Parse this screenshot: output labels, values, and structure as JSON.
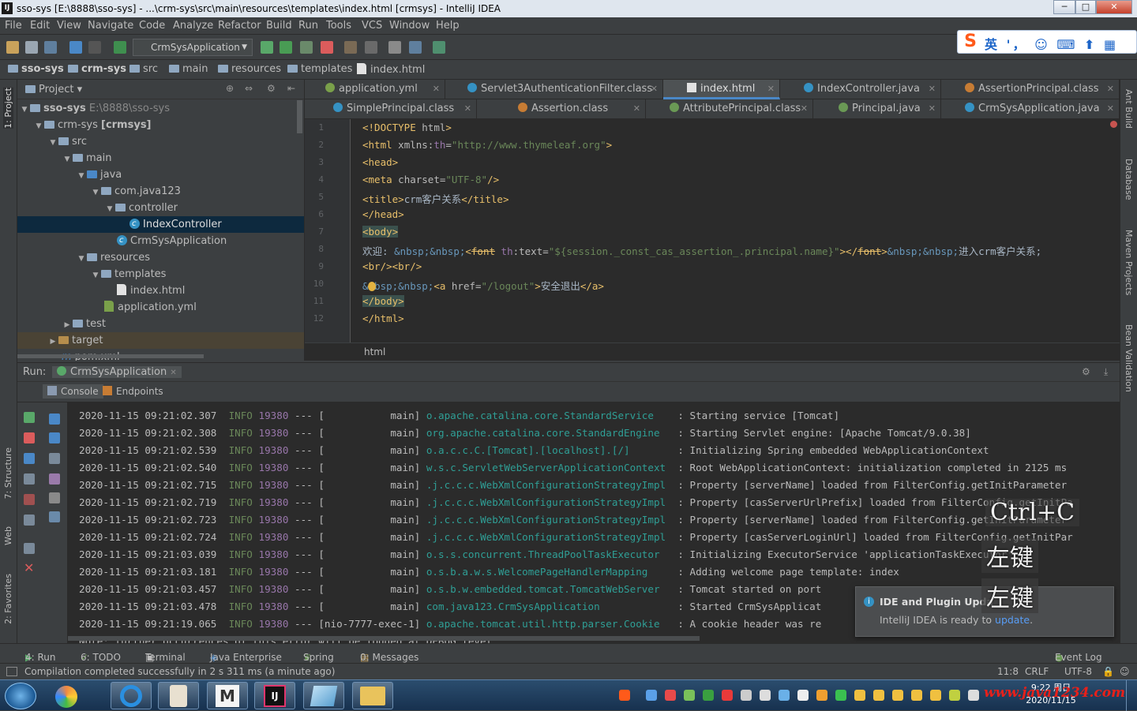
{
  "window": {
    "title": "sso-sys [E:\\8888\\sso-sys] - ...\\crm-sys\\src\\main\\resources\\templates\\index.html [crmsys] - IntelliJ IDEA",
    "app_icon": "IJ",
    "buttons": [
      "─",
      "□",
      "✕"
    ]
  },
  "menu": [
    "File",
    "Edit",
    "View",
    "Navigate",
    "Code",
    "Analyze",
    "Refactor",
    "Build",
    "Run",
    "Tools",
    "VCS",
    "Window",
    "Help"
  ],
  "toolbar": {
    "run_config": "CrmSysApplication"
  },
  "ime": {
    "mode": "英",
    "punct": "'，",
    "logo": "S"
  },
  "breadcrumb_nav": [
    "sso-sys",
    "crm-sys",
    "src",
    "main",
    "resources",
    "templates",
    "index.html"
  ],
  "project_panel": {
    "title": "Project",
    "tree": [
      {
        "label": "sso-sys",
        "extra": "E:\\8888\\sso-sys"
      },
      {
        "label": "crm-sys",
        "extra": "[crmsys]"
      },
      {
        "label": "src"
      },
      {
        "label": "main"
      },
      {
        "label": "java"
      },
      {
        "label": "com.java123"
      },
      {
        "label": "controller"
      },
      {
        "label": "IndexController"
      },
      {
        "label": "CrmSysApplication"
      },
      {
        "label": "resources"
      },
      {
        "label": "templates"
      },
      {
        "label": "index.html"
      },
      {
        "label": "application.yml"
      },
      {
        "label": "test"
      },
      {
        "label": "target"
      },
      {
        "label": "pom.xml"
      }
    ]
  },
  "editor_tabs_row1": [
    "application.yml",
    "Servlet3AuthenticationFilter.class",
    "index.html",
    "IndexController.java",
    "AssertionPrincipal.class"
  ],
  "editor_tabs_row2": [
    "SimplePrincipal.class",
    "Assertion.class",
    "AttributePrincipal.class",
    "Principal.java",
    "CrmSysApplication.java"
  ],
  "code_lines": [
    {
      "n": "1",
      "html": "<span class='tg'>&lt;!DOCTYPE</span> <span class='at'>html</span><span class='tg'>&gt;</span>"
    },
    {
      "n": "2",
      "html": "<span class='tg'>&lt;html</span> <span class='at'>xmlns:</span><span class='ns'>th</span><span class='at'>=</span><span class='av'>\"http://www.thymeleaf.org\"</span><span class='tg'>&gt;</span>"
    },
    {
      "n": "3",
      "html": "<span class='tg'>&lt;head&gt;</span>"
    },
    {
      "n": "4",
      "html": "<span class='tg'>&lt;meta</span> <span class='at'>charset=</span><span class='av'>\"UTF-8\"</span><span class='tg'>/&gt;</span>"
    },
    {
      "n": "5",
      "html": "<span class='tg'>&lt;title&gt;</span>crm客户关系<span class='tg'>&lt;/title&gt;</span>"
    },
    {
      "n": "6",
      "html": "<span class='tg'>&lt;/head&gt;</span>"
    },
    {
      "n": "7",
      "html": "<span class='tg' style='background:#3b514d'>&lt;body&gt;</span>"
    },
    {
      "n": "8",
      "html": "欢迎: <span class='en'>&amp;nbsp;&amp;nbsp;</span><span class='tg'>&lt;<s>font</s></span> <span class='ns'>th</span><span class='at'>:text=</span><span class='av'>\"${session._const_cas_assertion_.principal.name}\"</span><span class='tg'>&gt;&lt;/<s>font</s>&gt;</span><span class='en'>&amp;nbsp;&amp;nbsp;</span>进入crm客户关系;"
    },
    {
      "n": "9",
      "html": "<span class='tg'>&lt;br/&gt;&lt;br/&gt;</span>"
    },
    {
      "n": "10",
      "html": "<span class='en'>&amp;nbsp;&amp;nbsp;</span><span class='tg'>&lt;a</span> <span class='at'>href=</span><span class='av'>\"/logout\"</span><span class='tg'>&gt;</span>安全退出<span class='tg'>&lt;/a&gt;</span>"
    },
    {
      "n": "11",
      "html": "<span class='tg' style='background:#3b514d'>&lt;/body&gt;</span>"
    },
    {
      "n": "12",
      "html": "<span class='tg'>&lt;/html&gt;</span>"
    }
  ],
  "editor_breadcrumb": "html",
  "run_panel": {
    "label": "Run:",
    "tab": "CrmSysApplication",
    "subtabs": [
      "Console",
      "Endpoints"
    ]
  },
  "console_lines": [
    {
      "ts": "2020-11-15 09:21:02.307",
      "lvl": "INFO",
      "pid": "19380",
      "th": "[           main]",
      "lg": "o.apache.catalina.core.StandardService  ",
      "msg": " : Starting service [Tomcat]"
    },
    {
      "ts": "2020-11-15 09:21:02.308",
      "lvl": "INFO",
      "pid": "19380",
      "th": "[           main]",
      "lg": "org.apache.catalina.core.StandardEngine ",
      "msg": " : Starting Servlet engine: [Apache Tomcat/9.0.38]"
    },
    {
      "ts": "2020-11-15 09:21:02.539",
      "lvl": "INFO",
      "pid": "19380",
      "th": "[           main]",
      "lg": "o.a.c.c.C.[Tomcat].[localhost].[/]      ",
      "msg": " : Initializing Spring embedded WebApplicationContext"
    },
    {
      "ts": "2020-11-15 09:21:02.540",
      "lvl": "INFO",
      "pid": "19380",
      "th": "[           main]",
      "lg": "w.s.c.ServletWebServerApplicationContext",
      "msg": " : Root WebApplicationContext: initialization completed in 2125 ms"
    },
    {
      "ts": "2020-11-15 09:21:02.715",
      "lvl": "INFO",
      "pid": "19380",
      "th": "[           main]",
      "lg": ".j.c.c.c.WebXmlConfigurationStrategyImpl",
      "msg": " : Property [serverName] loaded from FilterConfig.getInitParameter"
    },
    {
      "ts": "2020-11-15 09:21:02.719",
      "lvl": "INFO",
      "pid": "19380",
      "th": "[           main]",
      "lg": ".j.c.c.c.WebXmlConfigurationStrategyImpl",
      "msg": " : Property [casServerUrlPrefix] loaded from FilterConfig.getInitPa"
    },
    {
      "ts": "2020-11-15 09:21:02.723",
      "lvl": "INFO",
      "pid": "19380",
      "th": "[           main]",
      "lg": ".j.c.c.c.WebXmlConfigurationStrategyImpl",
      "msg": " : Property [serverName] loaded from FilterConfig.getInitParameter"
    },
    {
      "ts": "2020-11-15 09:21:02.724",
      "lvl": "INFO",
      "pid": "19380",
      "th": "[           main]",
      "lg": ".j.c.c.c.WebXmlConfigurationStrategyImpl",
      "msg": " : Property [casServerLoginUrl] loaded from FilterConfig.getInitPar"
    },
    {
      "ts": "2020-11-15 09:21:03.039",
      "lvl": "INFO",
      "pid": "19380",
      "th": "[           main]",
      "lg": "o.s.s.concurrent.ThreadPoolTaskExecutor ",
      "msg": " : Initializing ExecutorService 'applicationTaskExecutor'"
    },
    {
      "ts": "2020-11-15 09:21:03.181",
      "lvl": "INFO",
      "pid": "19380",
      "th": "[           main]",
      "lg": "o.s.b.a.w.s.WelcomePageHandlerMapping   ",
      "msg": " : Adding welcome page template: index"
    },
    {
      "ts": "2020-11-15 09:21:03.457",
      "lvl": "INFO",
      "pid": "19380",
      "th": "[           main]",
      "lg": "o.s.b.w.embedded.tomcat.TomcatWebServer ",
      "msg": " : Tomcat started on port"
    },
    {
      "ts": "2020-11-15 09:21:03.478",
      "lvl": "INFO",
      "pid": "19380",
      "th": "[           main]",
      "lg": "com.java123.CrmSysApplication           ",
      "msg": " : Started CrmSysApplicat"
    },
    {
      "ts": "2020-11-15 09:21:19.065",
      "lvl": "INFO",
      "pid": "19380",
      "th": "[nio-7777-exec-1]",
      "lg": "o.apache.tomcat.util.http.parser.Cookie ",
      "msg": " : A cookie header was re"
    },
    {
      "ts": "Note: further occurrences of this error will be logged at DEBUG level.",
      "lvl": "",
      "pid": "",
      "th": "",
      "lg": "",
      "msg": ""
    }
  ],
  "notification": {
    "title": "IDE and Plugin Upda",
    "body_prefix": "IntelliJ IDEA is ready to ",
    "link": "update",
    "body_suffix": "."
  },
  "overlays": [
    "Ctrl+C",
    "左键",
    "左键"
  ],
  "bottom_tools": [
    "4: Run",
    "6: TODO",
    "Terminal",
    "Java Enterprise",
    "Spring",
    "0: Messages"
  ],
  "event_log": "Event Log",
  "status": {
    "message": "Compilation completed successfully in 2 s 311 ms (a minute ago)",
    "position": "11:8",
    "line_sep": "CRLF",
    "encoding": "UTF-8"
  },
  "left_strip": [
    "1: Project",
    "7: Structure",
    "Web",
    "2: Favorites"
  ],
  "right_strip": [
    "Ant Build",
    "Database",
    "Maven Projects",
    "Bean Validation"
  ],
  "taskbar": {
    "time": "9:22 周日",
    "date": "2020/11/15"
  },
  "watermark": "www.java1234.com"
}
